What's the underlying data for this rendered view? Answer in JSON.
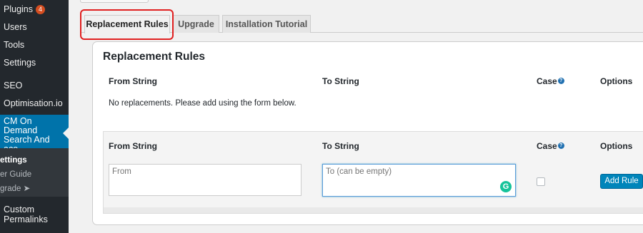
{
  "sidebar": {
    "items": [
      {
        "label": "Plugins",
        "badge": "4"
      },
      {
        "label": "Users"
      },
      {
        "label": "Tools"
      },
      {
        "label": "Settings"
      },
      {
        "label": "SEO"
      },
      {
        "label": "Optimisation.io"
      },
      {
        "label": "CM On Demand Search And\nace"
      },
      {
        "label": "ettings"
      },
      {
        "label": "er Guide"
      },
      {
        "label": "grade ➤"
      },
      {
        "label": "Custom Permalinks"
      }
    ]
  },
  "tabs": [
    {
      "label": "Replacement Rules"
    },
    {
      "label": "Upgrade"
    },
    {
      "label": "Installation Tutorial"
    }
  ],
  "panel": {
    "title": "Replacement Rules",
    "headers": {
      "from": "From String",
      "to": "To String",
      "case": "Case",
      "options": "Options"
    },
    "empty_message": "No replacements. Please add using the form below."
  },
  "form": {
    "headers": {
      "from": "From String",
      "to": "To String",
      "case": "Case",
      "options": "Options"
    },
    "from_placeholder": "From",
    "to_placeholder": "To (can be empty)",
    "add_button": "Add Rule"
  },
  "colors": {
    "accent": "#0073aa",
    "button": "#0085ba",
    "highlight": "#e02020"
  }
}
